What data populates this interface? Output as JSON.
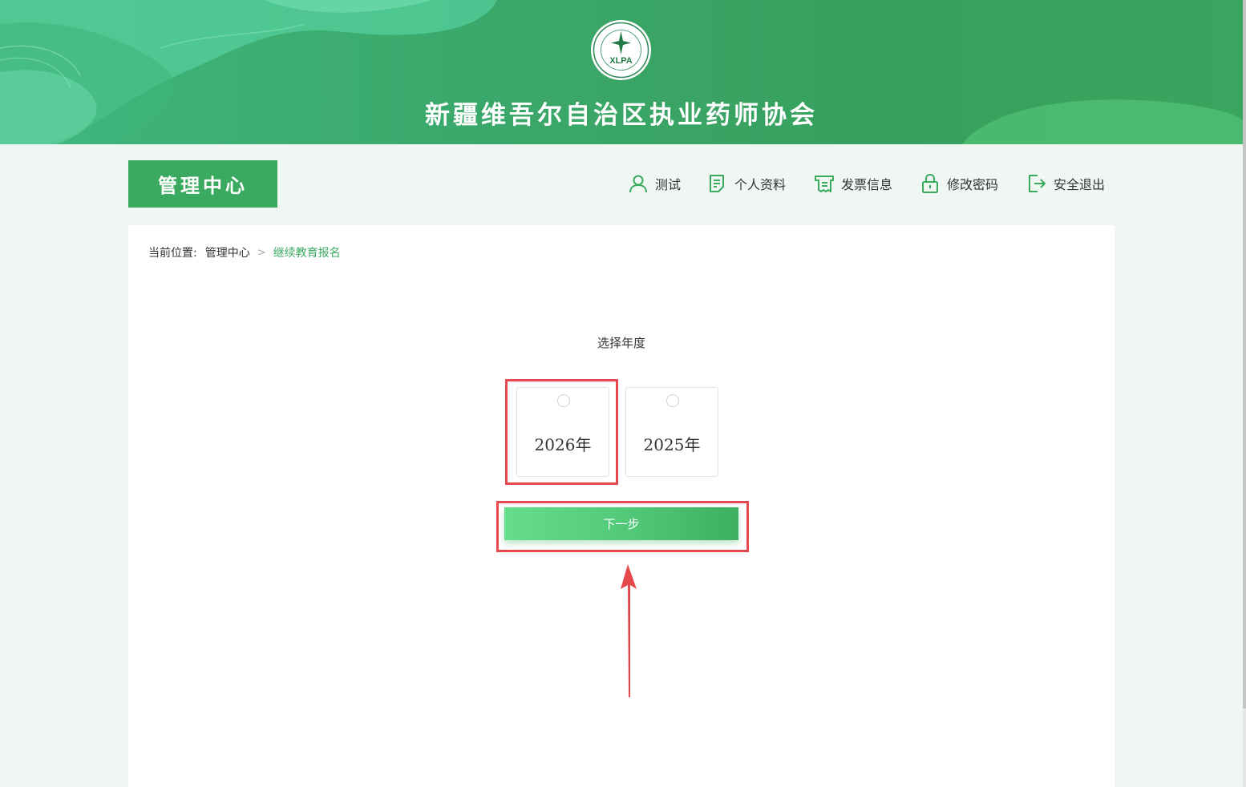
{
  "header": {
    "logo_text": "XLPA",
    "logo_ring_text": "新疆维吾尔自治区执业药师协会",
    "site_title": "新疆维吾尔自治区执业药师协会"
  },
  "nav": {
    "section_label": "管理中心",
    "items": [
      {
        "label": "测试",
        "icon": "user-icon"
      },
      {
        "label": "个人资料",
        "icon": "document-icon"
      },
      {
        "label": "发票信息",
        "icon": "invoice-icon"
      },
      {
        "label": "修改密码",
        "icon": "lock-icon"
      },
      {
        "label": "安全退出",
        "icon": "logout-icon"
      }
    ]
  },
  "breadcrumb": {
    "prefix": "当前位置:",
    "home": "管理中心",
    "separator": ">",
    "current": "继续教育报名"
  },
  "main": {
    "section_title": "选择年度",
    "years": [
      {
        "label": "2026年",
        "selected": false
      },
      {
        "label": "2025年",
        "selected": false
      }
    ],
    "next_label": "下一步"
  },
  "colors": {
    "brand_green": "#3aaa60",
    "highlight_red": "#e5484d"
  }
}
